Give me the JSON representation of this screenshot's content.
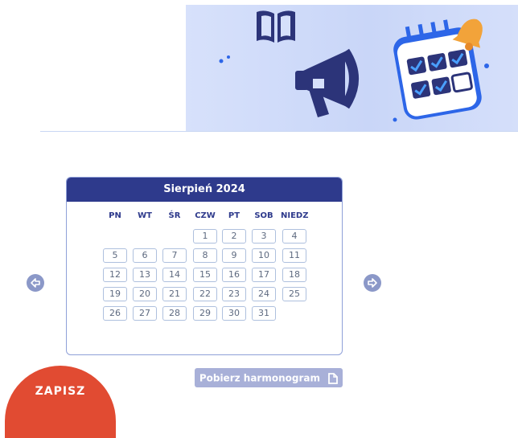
{
  "calendar": {
    "month_title": "Sierpień 2024",
    "weekdays": [
      "PN",
      "WT",
      "ŚR",
      "CZW",
      "PT",
      "SOB",
      "NIEDZ"
    ],
    "days": [
      "1",
      "2",
      "3",
      "4",
      "5",
      "6",
      "7",
      "8",
      "9",
      "10",
      "11",
      "12",
      "13",
      "14",
      "15",
      "16",
      "17",
      "18",
      "19",
      "20",
      "21",
      "22",
      "23",
      "24",
      "25",
      "26",
      "27",
      "28",
      "29",
      "30",
      "31"
    ]
  },
  "nav": {
    "prev_icon": "arrow-left-icon",
    "next_icon": "arrow-right-icon"
  },
  "download": {
    "label": "Pobierz harmonogram",
    "icon": "document-icon"
  },
  "cta": {
    "label": "ZAPISZ"
  },
  "colors": {
    "header": "#2e3a8c",
    "banner": "#cfdaf8",
    "cta": "#e14b32",
    "button": "#a8b0d8"
  }
}
